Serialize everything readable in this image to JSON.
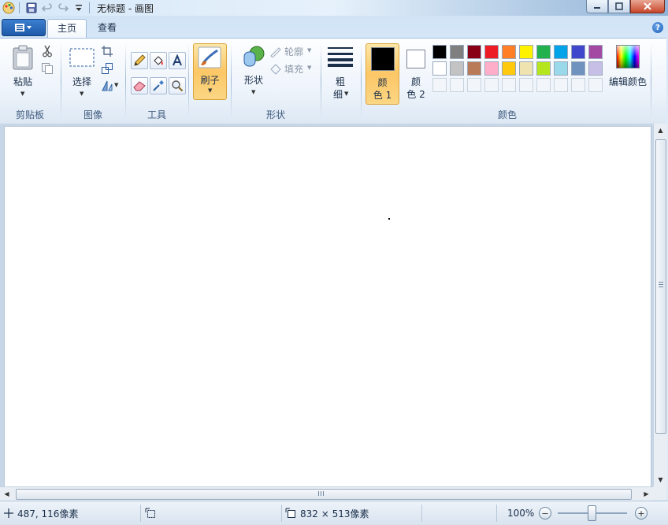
{
  "window": {
    "title": "无标题 - 画图",
    "minimize_icon": "minimize-icon",
    "maximize_icon": "maximize-icon",
    "close_icon": "close-icon"
  },
  "tabs": [
    {
      "label": "主页",
      "active": true
    },
    {
      "label": "查看",
      "active": false
    }
  ],
  "ribbon": {
    "clipboard": {
      "group_label": "剪贴板",
      "paste_label": "粘贴"
    },
    "image": {
      "group_label": "图像",
      "select_label": "选择"
    },
    "tools": {
      "group_label": "工具"
    },
    "brush": {
      "label": "刷子"
    },
    "shapes": {
      "group_label": "形状",
      "shapes_label": "形状",
      "outline_label": "轮廓",
      "fill_label": "填充"
    },
    "size": {
      "label_line1": "粗",
      "label_line2": "细"
    },
    "colors": {
      "group_label": "颜色",
      "color1_line1": "颜",
      "color1_line2": "色 1",
      "color2_line1": "颜",
      "color2_line2": "色 2",
      "edit_colors_label": "编辑颜色",
      "color1_value": "#000000",
      "color2_value": "#ffffff",
      "palette_row1": [
        "#000000",
        "#7f7f7f",
        "#880015",
        "#ed1c24",
        "#ff7f27",
        "#fff200",
        "#22b14c",
        "#00a2e8",
        "#3f48cc",
        "#a349a4"
      ],
      "palette_row2": [
        "#ffffff",
        "#c3c3c3",
        "#b97a57",
        "#ffaec9",
        "#ffc90e",
        "#efe4b0",
        "#b5e61d",
        "#99d9ea",
        "#7092be",
        "#c8bfe7"
      ]
    }
  },
  "status": {
    "cursor_position": "487, 116像素",
    "canvas_size": "832 × 513像素",
    "zoom": "100%"
  }
}
